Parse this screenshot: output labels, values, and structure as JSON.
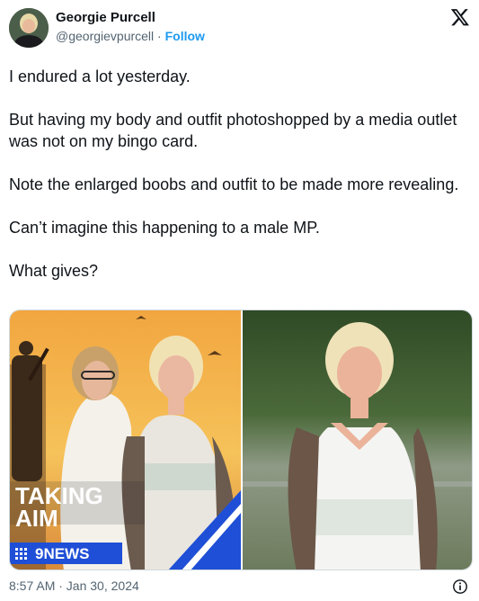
{
  "author": {
    "display_name": "Georgie Purcell",
    "handle": "@georgievpurcell",
    "separator": " · ",
    "follow_label": "Follow"
  },
  "tweet": {
    "paragraphs": [
      "I endured a lot yesterday.",
      "But having my body and outfit photoshopped by a media outlet was not on my bingo card.",
      "Note the enlarged boobs and outfit to be made more revealing.",
      "Can’t imagine this happening to a male MP.",
      "What gives?"
    ],
    "timestamp": "8:57 AM · Jan 30, 2024"
  },
  "media": {
    "left_overlay_line1": "TAKING",
    "left_overlay_line2": "AIM",
    "left_brand": "9NEWS"
  },
  "icons": {
    "platform_logo": "x-logo-icon",
    "info": "info-icon"
  },
  "colors": {
    "follow_blue": "#1d9bf0",
    "secondary_text": "#536471",
    "news_blue": "#1f4fd6"
  }
}
